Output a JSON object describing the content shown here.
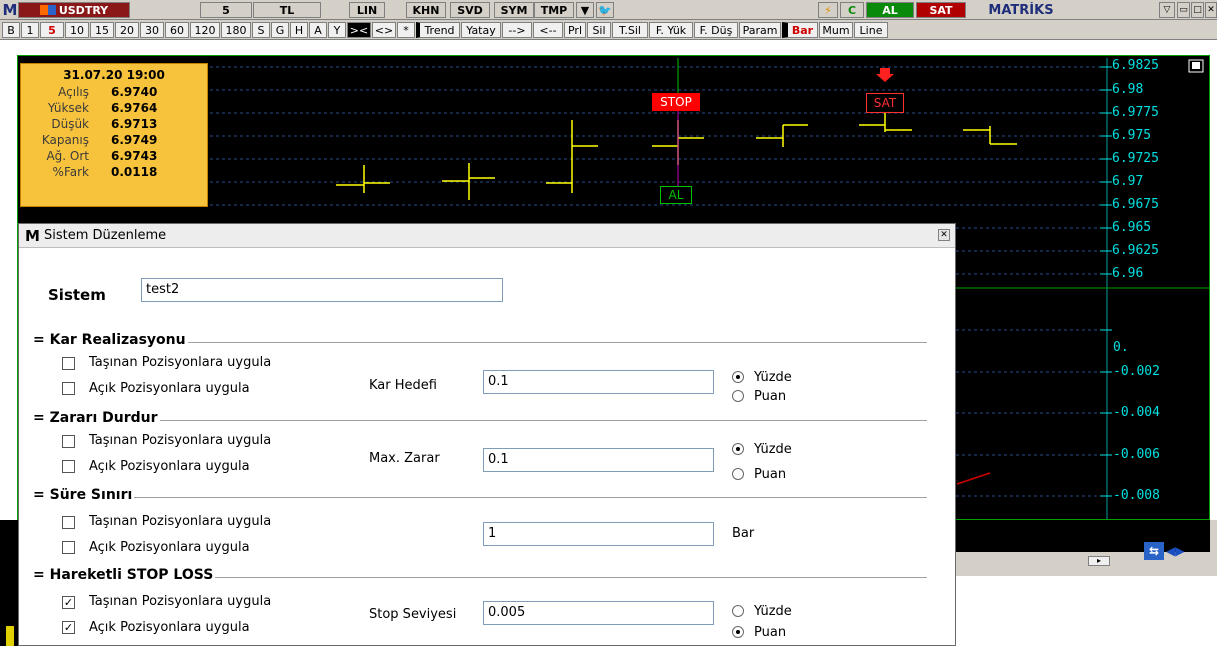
{
  "toolbar1": {
    "app_letter": "M",
    "symbol": "USDTRY",
    "period": "5",
    "currency": "TL",
    "buttons": [
      "LIN",
      "KHN",
      "SVD",
      "SYM",
      "TMP"
    ],
    "flash_icon": "lightning-icon",
    "c_label": "C",
    "al_label": "AL",
    "sat_label": "SAT",
    "brand": "MATRİKS"
  },
  "toolbar2": {
    "items": [
      "B",
      "1",
      "5",
      "10",
      "15",
      "20",
      "30",
      "60",
      "120",
      "180",
      "S",
      "G",
      "H",
      "A",
      "Y",
      "><",
      "<>",
      "*",
      "Trend",
      "Yatay",
      "-->",
      "<--",
      "Prl",
      "Sil",
      "T.Sil",
      "F. Yük",
      "F. Düş",
      "Param",
      "Bar",
      "Mum",
      "Line"
    ]
  },
  "chart": {
    "info": {
      "date": "31.07.20 19:00",
      "rows": [
        {
          "label": "Açılış",
          "value": "6.9740"
        },
        {
          "label": "Yüksek",
          "value": "6.9764"
        },
        {
          "label": "Düşük",
          "value": "6.9713"
        },
        {
          "label": "Kapanış",
          "value": "6.9749"
        },
        {
          "label": "Ağ. Ort",
          "value": "6.9743"
        },
        {
          "label": "%Fark",
          "value": "0.0118"
        }
      ]
    },
    "price_ticks": [
      "6.9825",
      "6.98",
      "6.9775",
      "6.975",
      "6.9725",
      "6.97",
      "6.9675",
      "6.965",
      "6.9625",
      "6.96"
    ],
    "osc_ticks": [
      "0.",
      "-0.002",
      "-0.004",
      "-0.006",
      "-0.008"
    ],
    "markers": {
      "stop": "STOP",
      "sat": "SAT",
      "al": "AL"
    },
    "colors": {
      "bars": "#ffff00",
      "axis": "#00e0e0",
      "stop_bg": "#ff0000",
      "al_border": "#00c000"
    }
  },
  "dialog": {
    "app_letter": "M",
    "title": "Sistem Düzenleme",
    "sistem_label": "Sistem",
    "sistem_value": "test2",
    "groups": [
      {
        "title": "Kar Realizasyonu",
        "check1": "Taşınan Pozisyonlara uygula",
        "check2": "Açık Pozisyonlara uygula",
        "field_label": "Kar Hedefi",
        "field_value": "0.1",
        "radio1": "Yüzde",
        "radio2": "Puan"
      },
      {
        "title": "Zararı Durdur",
        "check1": "Taşınan Pozisyonlara uygula",
        "check2": "Açık Pozisyonlara uygula",
        "field_label": "Max. Zarar",
        "field_value": "0.1",
        "radio1": "Yüzde",
        "radio2": "Puan"
      },
      {
        "title": "Süre Sınırı",
        "check1": "Taşınan Pozisyonlara uygula",
        "check2": "Açık Pozisyonlara uygula",
        "field_value": "1",
        "unit": "Bar"
      },
      {
        "title": "Hareketli STOP LOSS",
        "check1": "Taşınan Pozisyonlara uygula",
        "check2": "Açık Pozisyonlara uygula",
        "field_label": "Stop Seviyesi",
        "field_value": "0.005",
        "radio1": "Yüzde",
        "radio2": "Puan"
      }
    ]
  }
}
